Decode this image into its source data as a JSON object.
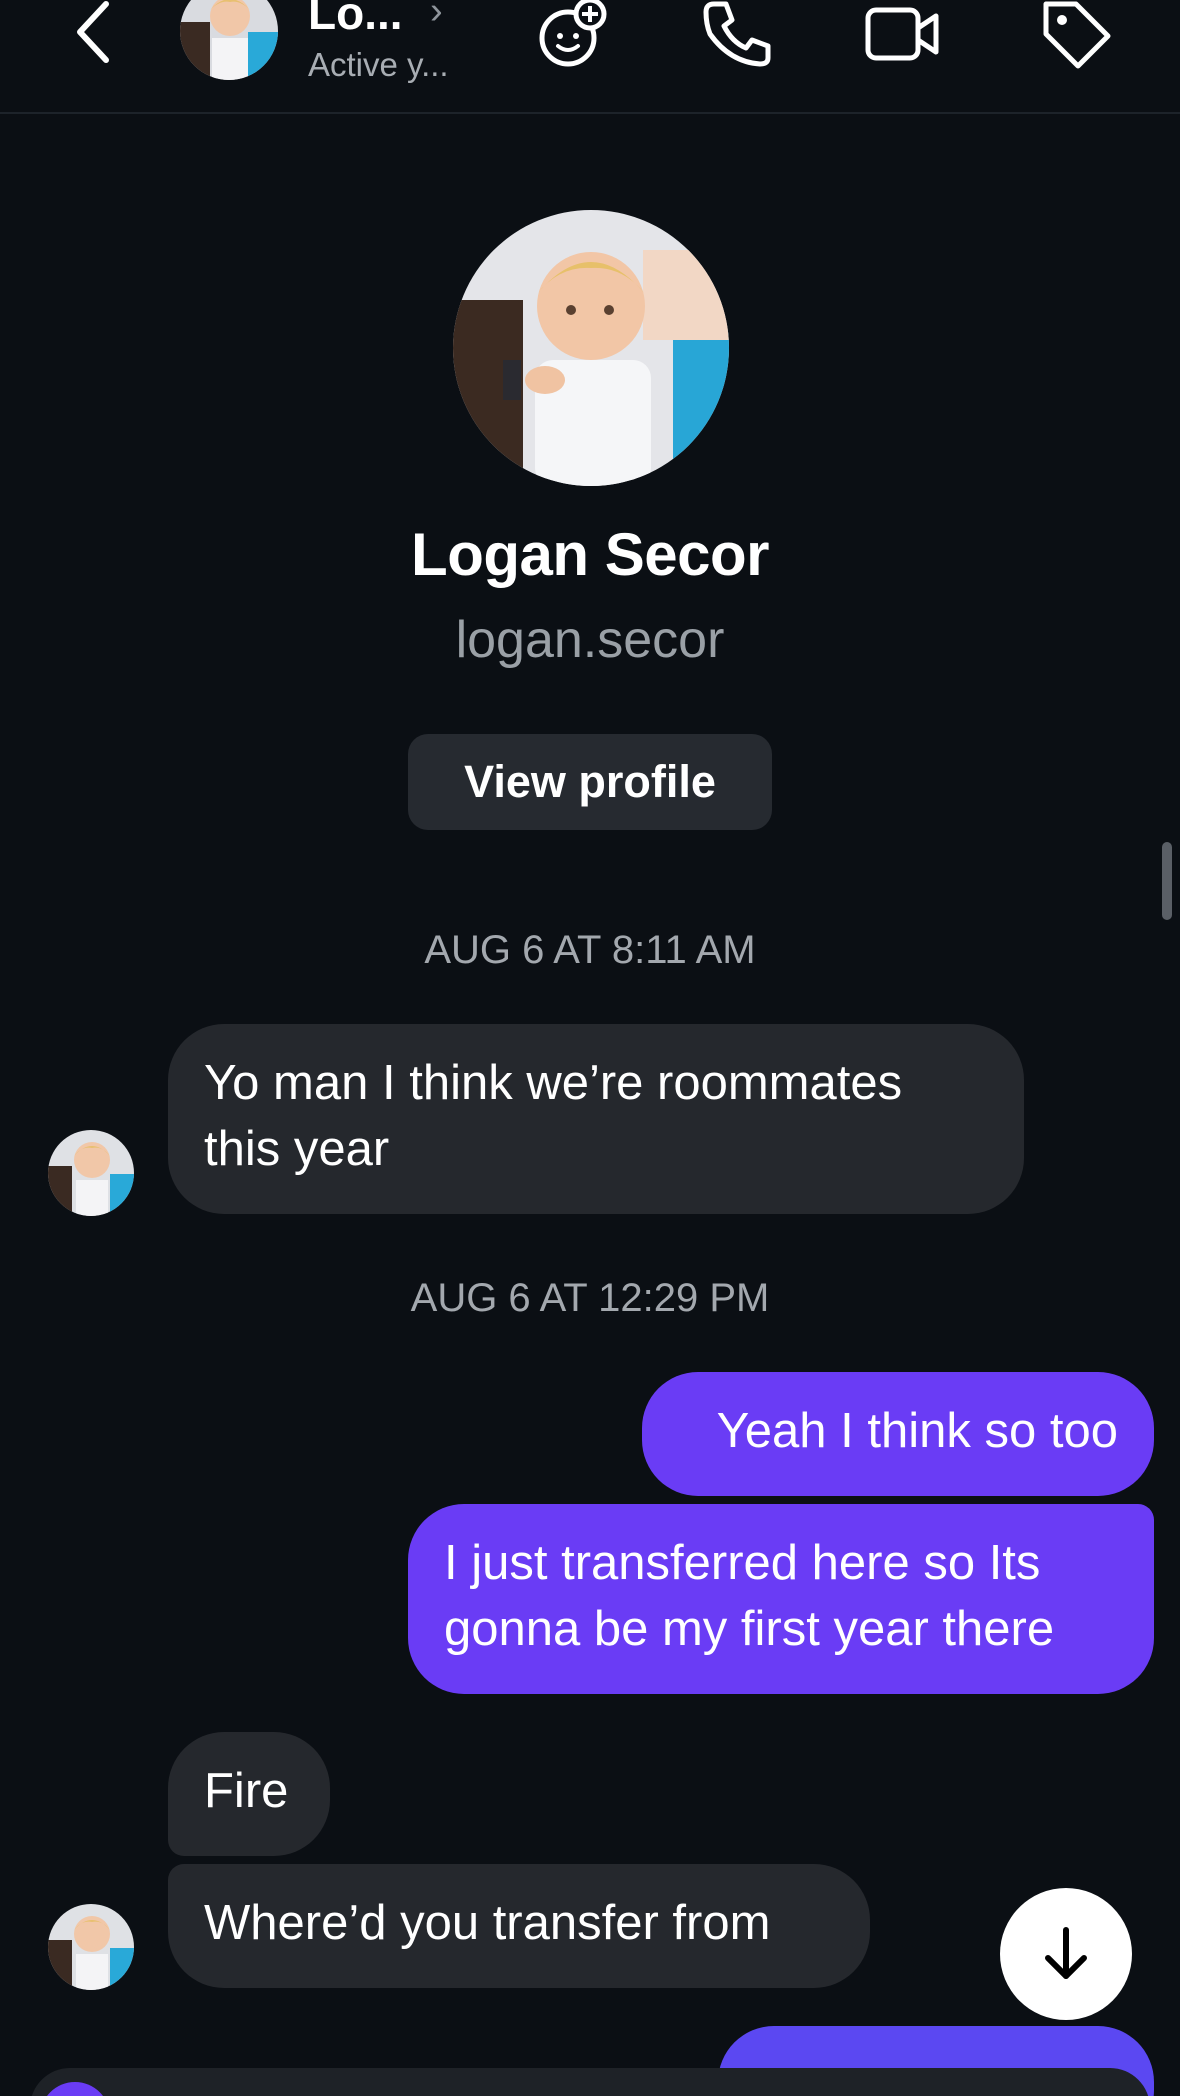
{
  "header": {
    "name": "Lo...",
    "status": "Active y...",
    "icons": [
      "back-chevron-icon",
      "effects-icon",
      "phone-icon",
      "video-icon",
      "tag-icon"
    ]
  },
  "profile": {
    "name": "Logan Secor",
    "username": "logan.secor",
    "view_profile_label": "View profile"
  },
  "messages": {
    "timestamp_1": "AUG 6 AT 8:11 AM",
    "incoming_1_line1": "Yo man I think we’re roommates",
    "incoming_1_line2": "this year",
    "timestamp_2": "AUG 6 AT 12:29 PM",
    "outgoing_1": "Yeah I think so too",
    "outgoing_2_line1": "I just transferred here so Its",
    "outgoing_2_line2": "gonna be my first year there",
    "incoming_2": "Fire",
    "incoming_3": "Where’d you transfer from"
  },
  "colors": {
    "background": "#0b0f14",
    "incoming_bubble": "#25282d",
    "outgoing_bubble": "#6a3cf5",
    "button": "#262a30"
  }
}
